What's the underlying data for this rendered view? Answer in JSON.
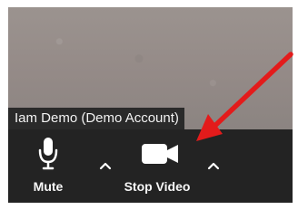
{
  "participant": {
    "name": "Iam Demo (Demo Account)"
  },
  "controls": {
    "mute_label": "Mute",
    "stop_video_label": "Stop Video"
  },
  "icons": {
    "microphone": "microphone-icon",
    "camera": "video-camera-icon",
    "caret": "chevron-up-icon",
    "annotation_arrow": "arrow-icon"
  },
  "colors": {
    "toolbar": "#232323",
    "video_background": "#948a87",
    "label": "#f7f7f7",
    "arrow": "#e31b1b"
  }
}
